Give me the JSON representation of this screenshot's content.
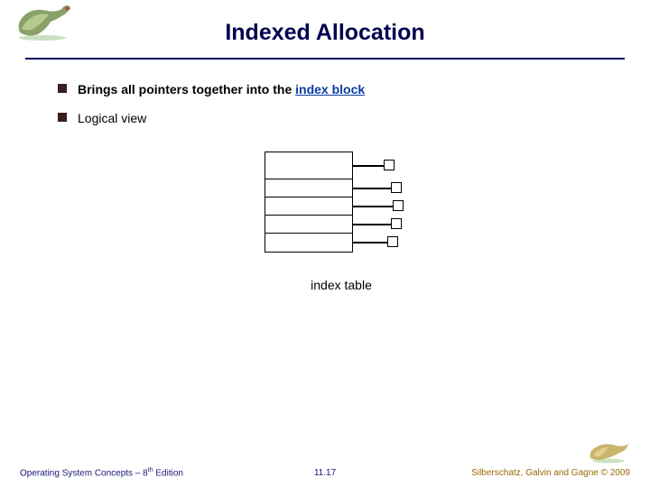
{
  "header": {
    "title": "Indexed Allocation"
  },
  "bullets": [
    {
      "prefix": "Brings all pointers together into the ",
      "link": "index block",
      "suffix": ""
    },
    {
      "prefix": "Logical view",
      "link": "",
      "suffix": ""
    }
  ],
  "diagram": {
    "caption": "index table"
  },
  "footer": {
    "left_prefix": "Operating System Concepts – 8",
    "left_sup": "th",
    "left_suffix": " Edition",
    "center": "11.17",
    "right": "Silberschatz, Galvin and Gagne © 2009"
  },
  "icons": {
    "dino_left": "dinosaur-left",
    "dino_right": "dinosaur-right"
  }
}
